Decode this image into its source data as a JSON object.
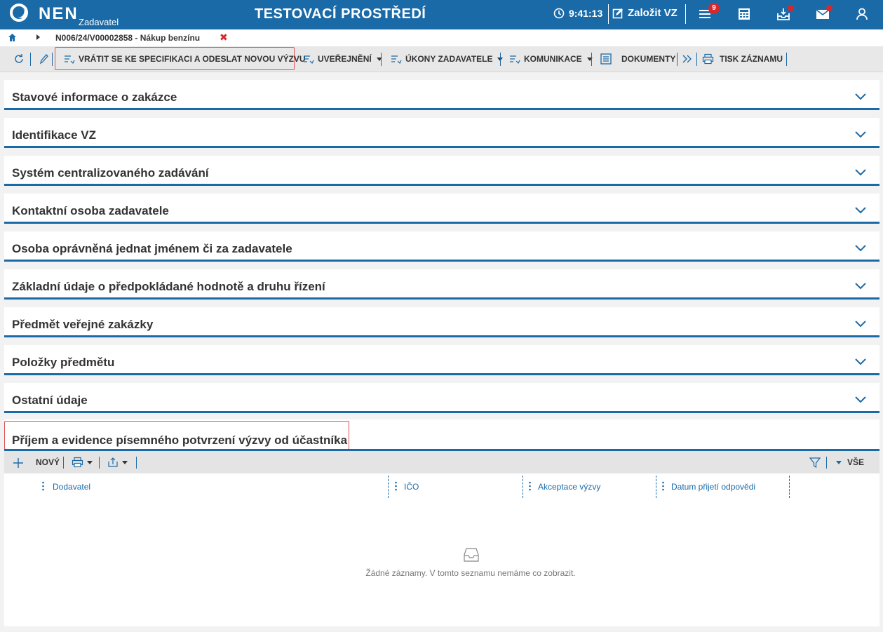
{
  "header": {
    "logo": "NEN",
    "role": "Zadavatel",
    "environment": "TESTOVACÍ PROSTŘEDÍ",
    "time": "9:41:13",
    "create_label": "Založit VZ",
    "notifications_count": "9",
    "brand_color": "#1b6aa8",
    "alert_color": "#d9262b"
  },
  "breadcrumb": {
    "record": "N006/24/V00002858 - Nákup benzínu"
  },
  "toolbar": {
    "return_label": "VRÁTIT SE KE SPECIFIKACI A ODESLAT NOVOU VÝZVU",
    "publish_label": "UVEŘEJNĚNÍ",
    "actions_label": "ÚKONY ZADAVATELE",
    "communication_label": "KOMUNIKACE",
    "documents_label": "DOKUMENTY",
    "print_label": "TISK ZÁZNAMU"
  },
  "sections": [
    {
      "title": "Stavové informace o zakázce"
    },
    {
      "title": "Identifikace VZ"
    },
    {
      "title": "Systém centralizovaného zadávání"
    },
    {
      "title": "Kontaktní osoba zadavatele"
    },
    {
      "title": "Osoba oprávněná jednat jménem či za zadavatele"
    },
    {
      "title": "Základní údaje o předpokládané hodnotě a druhu řízení"
    },
    {
      "title": "Předmět veřejné zakázky"
    },
    {
      "title": "Položky předmětu"
    },
    {
      "title": "Ostatní údaje"
    }
  ],
  "confirmation_section": {
    "title": "Příjem a evidence písemného potvrzení výzvy od účastníka",
    "new_label": "NOVÝ",
    "filter_label": "VŠE",
    "columns": [
      "Dodavatel",
      "IČO",
      "Akceptace výzvy",
      "Datum přijetí odpovědi"
    ],
    "empty_text": "Žádné záznamy. V tomto seznamu nemáme co zobrazit."
  }
}
